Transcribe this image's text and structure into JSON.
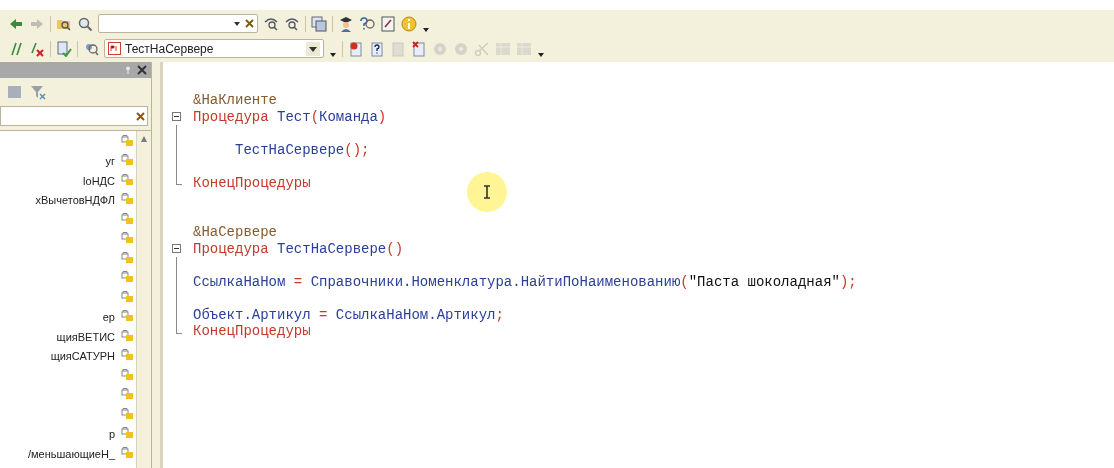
{
  "toolbar": {
    "row_1": [
      {
        "disabled": false
      },
      {
        "disabled": true
      },
      {
        "disabled": false
      },
      {
        "disabled": false
      },
      {
        "kind": "search_field"
      },
      {
        "disabled": false
      },
      {
        "disabled": false
      },
      {
        "disabled": false
      },
      {
        "disabled": false
      },
      {
        "disabled": false
      },
      {
        "disabled": false
      },
      {
        "disabled": false
      }
    ],
    "row_2": [
      {
        "disabled": false
      },
      {
        "disabled": false
      },
      {
        "disabled": false
      },
      {
        "disabled": false
      },
      {
        "kind": "procedure_combo",
        "value": "ТестНаСервере"
      },
      {
        "disabled": false
      },
      {
        "disabled": false
      },
      {
        "disabled": true
      },
      {
        "disabled": false
      },
      {
        "disabled": true
      },
      {
        "disabled": true
      },
      {
        "disabled": true
      },
      {
        "disabled": true
      },
      {
        "disabled": true
      }
    ]
  },
  "tree": {
    "rows": [
      {},
      {
        "label": "уг"
      },
      {
        "label": "loНДС"
      },
      {
        "label": "хВычетовНДФЛ"
      },
      {},
      {},
      {},
      {},
      {},
      {
        "label": "ер"
      },
      {
        "label": "щияВЕТИС"
      },
      {
        "label": "щияСАТУРН"
      },
      {},
      {},
      {},
      {
        "label": "р"
      },
      {
        "label": "/меньшающиеН_"
      }
    ]
  },
  "editor": {
    "lines": [
      {
        "kind": "plain",
        "tokens": [
          {
            "kind": "directive",
            "text": "&НаКлиенте"
          }
        ]
      },
      {
        "kind": "fold_start",
        "tokens": [
          {
            "kind": "keyword",
            "text": "Процедура"
          },
          {
            "kind": "ident",
            "text": " Тест"
          },
          {
            "kind": "op",
            "text": "("
          },
          {
            "kind": "ident",
            "text": "Команда"
          },
          {
            "kind": "op",
            "text": ")"
          }
        ]
      },
      {
        "kind": "fold_body"
      },
      {
        "kind": "fold_body",
        "tokens": [
          {
            "kind": "ident",
            "text": "     ТестНаСервере"
          },
          {
            "kind": "op",
            "text": "();"
          }
        ]
      },
      {
        "kind": "fold_body"
      },
      {
        "kind": "fold_end",
        "tokens": [
          {
            "kind": "keyword",
            "text": "КонецПроцедуры"
          }
        ]
      },
      {
        "kind": "plain"
      },
      {
        "kind": "plain"
      },
      {
        "kind": "plain",
        "tokens": [
          {
            "kind": "directive",
            "text": "&НаСервере"
          }
        ]
      },
      {
        "kind": "fold_start",
        "tokens": [
          {
            "kind": "keyword",
            "text": "Процедура"
          },
          {
            "kind": "ident",
            "text": " ТестНаСервере"
          },
          {
            "kind": "op",
            "text": "()"
          }
        ]
      },
      {
        "kind": "fold_body"
      },
      {
        "kind": "fold_body",
        "tokens": [
          {
            "kind": "ident",
            "text": "СсылкаНаНом "
          },
          {
            "kind": "op",
            "text": "="
          },
          {
            "kind": "ident",
            "text": " Справочники.Номенклатура.НайтиПоНаименованию"
          },
          {
            "kind": "op",
            "text": "("
          },
          {
            "kind": "string",
            "text": "\"Паста шоколадная\""
          },
          {
            "kind": "op",
            "text": ");"
          }
        ]
      },
      {
        "kind": "fold_body"
      },
      {
        "kind": "fold_body",
        "tokens": [
          {
            "kind": "ident",
            "text": "Объект.Артикул "
          },
          {
            "kind": "op",
            "text": "="
          },
          {
            "kind": "ident",
            "text": " СсылкаНаНом.Артикул"
          },
          {
            "kind": "op",
            "text": ";"
          }
        ]
      },
      {
        "kind": "fold_end",
        "tokens": [
          {
            "kind": "keyword",
            "text": "КонецПроцедуры"
          }
        ]
      }
    ]
  }
}
